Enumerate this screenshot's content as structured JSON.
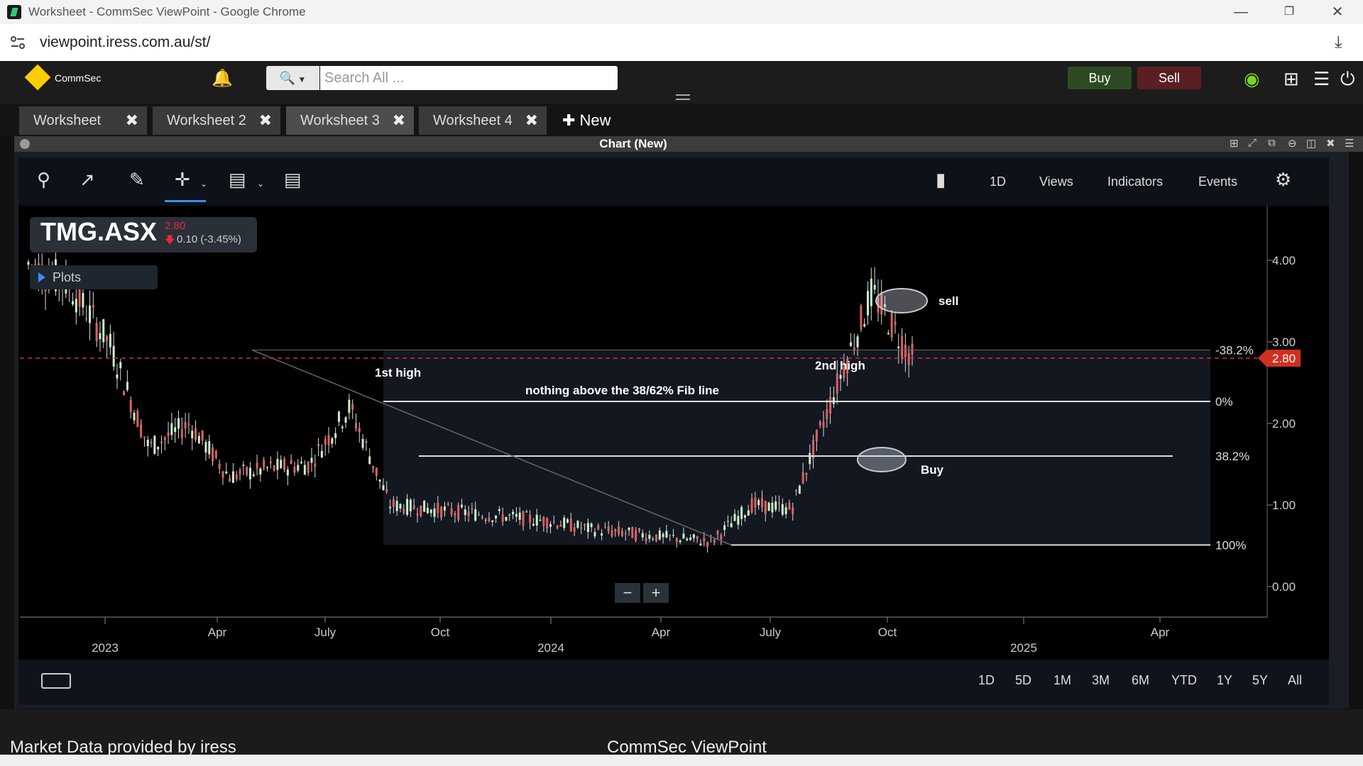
{
  "browser": {
    "window_title": "Worksheet - CommSec ViewPoint - Google Chrome",
    "url": "viewpoint.iress.com.au/st/"
  },
  "header": {
    "logo_text": "CommSec",
    "search_placeholder": "Search All ...",
    "buy_label": "Buy",
    "sell_label": "Sell",
    "buy_color": "#2d4a22",
    "sell_color": "#5a1f23"
  },
  "tabs": [
    {
      "label": "Worksheet",
      "active": false
    },
    {
      "label": "Worksheet 2",
      "active": false
    },
    {
      "label": "Worksheet 3",
      "active": true
    },
    {
      "label": "Worksheet 4",
      "active": false
    }
  ],
  "new_tab_label": "New",
  "panel": {
    "title": "Chart (New)"
  },
  "toolbar": {
    "interval": "1D",
    "views": "Views",
    "indicators": "Indicators",
    "events": "Events"
  },
  "ticker": {
    "symbol": "TMG.ASX",
    "price": "2.80",
    "change": "0.10 (-3.45%)",
    "plots_label": "Plots"
  },
  "ranges": [
    "1D",
    "5D",
    "1M",
    "3M",
    "6M",
    "YTD",
    "1Y",
    "5Y",
    "All"
  ],
  "footer": {
    "left": "Market Data provided by  iress",
    "center": "CommSec ViewPoint"
  },
  "chart_data": {
    "type": "candlestick",
    "y_ticks": [
      "4.00",
      "3.00",
      "2.00",
      "1.00",
      "0.00"
    ],
    "ylim": [
      0,
      4.3
    ],
    "x_month_ticks": [
      "Apr",
      "July",
      "Oct",
      "Apr",
      "July",
      "Oct",
      "Apr"
    ],
    "x_year_ticks": [
      "2023",
      "2024",
      "2025"
    ],
    "last_price_label": "2.80",
    "fib_levels": [
      {
        "label": "-38.2%",
        "value": 2.9
      },
      {
        "label": "0%",
        "value": 2.27
      },
      {
        "label": "38.2%",
        "value": 1.6
      },
      {
        "label": "100%",
        "value": 0.51
      }
    ],
    "annotations": {
      "first_high": "1st high",
      "second_high": "2nd high",
      "fib_note": "nothing above the 38/62% Fib line",
      "sell": "sell",
      "buy": "Buy"
    },
    "series_trend": [
      [
        "2023-01",
        3.95
      ],
      [
        "2023-02",
        3.7
      ],
      [
        "2023-03",
        3.0
      ],
      [
        "2023-04",
        1.7
      ],
      [
        "2023-05",
        2.0
      ],
      [
        "2023-06",
        1.35
      ],
      [
        "2023-07",
        1.45
      ],
      [
        "2023-08",
        1.5
      ],
      [
        "2023-09",
        2.2
      ],
      [
        "2023-10",
        1.0
      ],
      [
        "2023-11",
        0.95
      ],
      [
        "2023-12",
        0.9
      ],
      [
        "2024-01",
        0.85
      ],
      [
        "2024-02",
        0.8
      ],
      [
        "2024-03",
        0.7
      ],
      [
        "2024-04",
        0.65
      ],
      [
        "2024-05",
        0.6
      ],
      [
        "2024-06",
        0.55
      ],
      [
        "2024-07",
        1.0
      ],
      [
        "2024-08",
        0.95
      ],
      [
        "2024-09",
        2.3
      ],
      [
        "2024-10",
        3.6
      ],
      [
        "2024-10b",
        2.8
      ]
    ]
  }
}
